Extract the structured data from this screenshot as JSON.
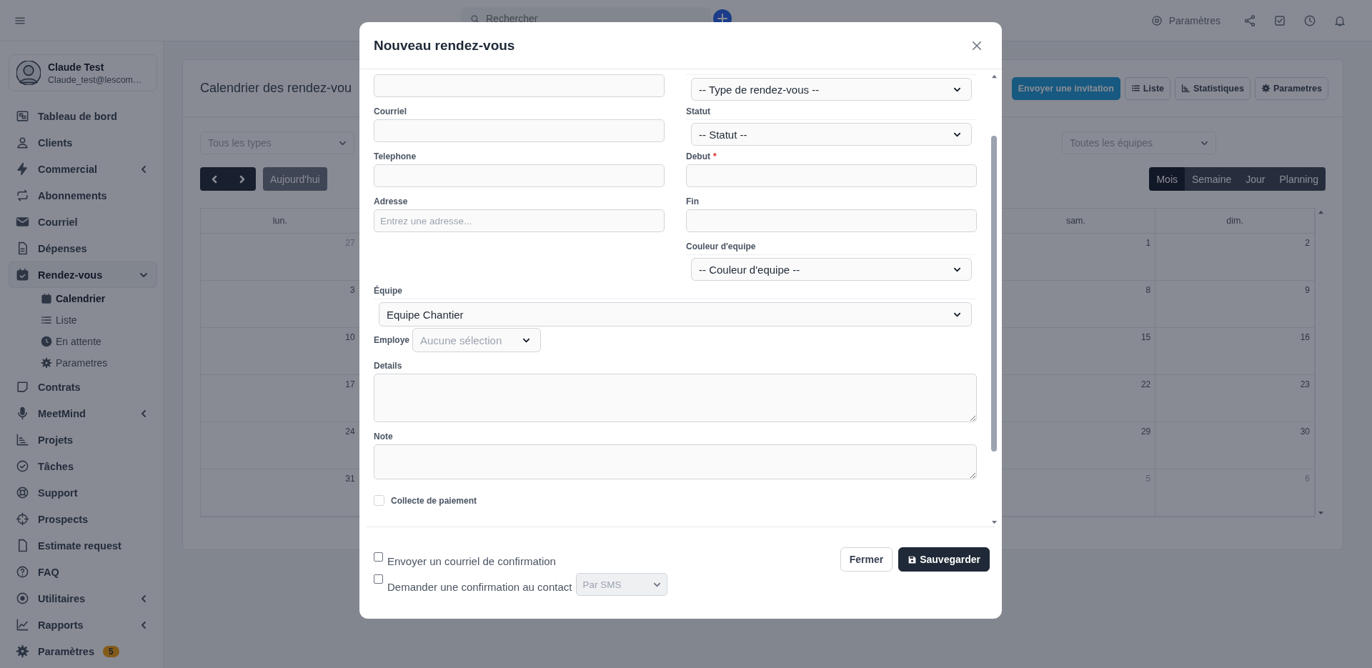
{
  "topbar": {
    "search_placeholder": "Rechercher",
    "settings_label": "Paramètres"
  },
  "sidebar": {
    "user": {
      "name": "Claude Test",
      "email": "Claude_test@lescom…"
    },
    "items": [
      {
        "label": "Tableau de bord",
        "selected": false
      },
      {
        "label": "Clients",
        "selected": false
      },
      {
        "label": "Commercial",
        "selected": false,
        "expanded": false
      },
      {
        "label": "Abonnements",
        "selected": false
      },
      {
        "label": "Courriel",
        "selected": false
      },
      {
        "label": "Dépenses",
        "selected": false
      },
      {
        "label": "Rendez-vous",
        "selected": true,
        "expanded": true,
        "children": [
          {
            "label": "Calendrier",
            "selected": true
          },
          {
            "label": "Liste",
            "selected": false
          },
          {
            "label": "En attente",
            "selected": false
          },
          {
            "label": "Parametres",
            "selected": false
          }
        ]
      },
      {
        "label": "Contrats",
        "selected": false
      },
      {
        "label": "MeetMind",
        "selected": false,
        "expanded": false
      },
      {
        "label": "Projets",
        "selected": false
      },
      {
        "label": "Tâches",
        "selected": false
      },
      {
        "label": "Support",
        "selected": false
      },
      {
        "label": "Prospects",
        "selected": false
      },
      {
        "label": "Estimate request",
        "selected": false
      },
      {
        "label": "FAQ",
        "selected": false
      },
      {
        "label": "Utilitaires",
        "selected": false,
        "expanded": false
      },
      {
        "label": "Rapports",
        "selected": false,
        "expanded": false
      },
      {
        "label": "Paramètres",
        "selected": false,
        "badge": "5"
      }
    ]
  },
  "page": {
    "title": "Calendrier des rendez-vou",
    "actions": [
      {
        "label": "Envoyer une invitation",
        "kind": "primary"
      },
      {
        "label": "Liste",
        "kind": "outline"
      },
      {
        "label": "Statistiques",
        "kind": "outline"
      },
      {
        "label": "Parametres",
        "kind": "outline"
      }
    ],
    "filters": [
      {
        "placeholder": "Tous les types"
      },
      {
        "placeholder": "Toutes les équipes"
      }
    ],
    "today": "Aujourd'hui",
    "views": [
      {
        "label": "Mois",
        "selected": true
      },
      {
        "label": "Semaine",
        "selected": false
      },
      {
        "label": "Jour",
        "selected": false
      },
      {
        "label": "Planning",
        "selected": false
      }
    ],
    "calendar": {
      "columns": [
        {
          "header": "lun.",
          "days": [
            {
              "number": "27",
              "other_month": true
            },
            {
              "number": "3",
              "other_month": false
            },
            {
              "number": "10",
              "other_month": false
            },
            {
              "number": "17",
              "other_month": false
            },
            {
              "number": "24",
              "other_month": false
            },
            {
              "number": "31",
              "other_month": false
            }
          ]
        },
        {
          "header": "sam.",
          "days": [
            {
              "number": "1",
              "other_month": false
            },
            {
              "number": "8",
              "other_month": false
            },
            {
              "number": "15",
              "other_month": false
            },
            {
              "number": "22",
              "other_month": false
            },
            {
              "number": "29",
              "other_month": false
            },
            {
              "number": "5",
              "other_month": true
            }
          ]
        },
        {
          "header": "dim.",
          "days": [
            {
              "number": "2",
              "other_month": false
            },
            {
              "number": "9",
              "other_month": false
            },
            {
              "number": "16",
              "other_month": false
            },
            {
              "number": "23",
              "other_month": false
            },
            {
              "number": "30",
              "other_month": false
            },
            {
              "number": "6",
              "other_month": true
            }
          ]
        }
      ]
    }
  },
  "modal": {
    "title": "Nouveau rendez-vous",
    "pairs": [
      {
        "left": {
          "kind": "text"
        },
        "right": {
          "kind": "select",
          "value": "-- Type de rendez-vous --"
        }
      },
      {
        "left": {
          "kind": "text",
          "label": "Courriel"
        },
        "right": {
          "kind": "select",
          "label": "Statut",
          "value": "-- Statut --"
        }
      },
      {
        "left": {
          "kind": "text",
          "label": "Telephone"
        },
        "right": {
          "kind": "text",
          "label": "Debut",
          "required_mark": "*"
        }
      },
      {
        "left": {
          "kind": "text",
          "label": "Adresse",
          "placeholder": "Entrez une adresse..."
        },
        "right": {
          "kind": "text",
          "label": "Fin"
        }
      },
      {
        "right": {
          "kind": "select",
          "label": "Couleur d'equipe",
          "value": "-- Couleur d'equipe --"
        }
      }
    ],
    "team": {
      "label": "Équipe",
      "value": "Equipe Chantier"
    },
    "employee": {
      "label": "Employe",
      "placeholder": "Aucune sélection"
    },
    "details": {
      "label": "Details"
    },
    "note": {
      "label": "Note"
    },
    "payment": {
      "label": "Collecte de paiement",
      "checked": false
    },
    "options": [
      {
        "label": "Envoyer un courriel de confirmation",
        "checked": false
      },
      {
        "label": "Demander une confirmation au contact",
        "checked": false,
        "select": {
          "value": "Par SMS",
          "disabled": true
        }
      }
    ],
    "buttons": [
      {
        "label": "Fermer",
        "kind": "secondary"
      },
      {
        "label": "Sauvegarder",
        "kind": "primary"
      }
    ]
  }
}
